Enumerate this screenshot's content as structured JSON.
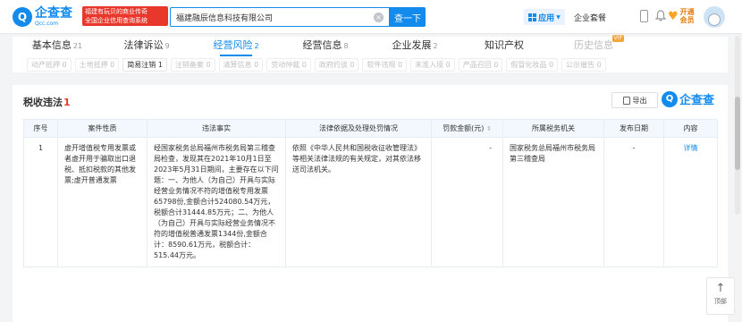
{
  "header": {
    "logo_mark": "Q",
    "logo_name": "企查查",
    "logo_domain": "Qcc.com",
    "promo_line1": "福建有玩贝的商业传奇",
    "promo_line2": "全国企业信用查询系统",
    "search_value": "福建融辰信息科技有限公司",
    "search_button": "查一下",
    "app_label": "应用",
    "package_label": "企业套餐",
    "vip_line1": "开通",
    "vip_line2": "会员"
  },
  "tabs": [
    {
      "label": "基本信息",
      "count": "21"
    },
    {
      "label": "法律诉讼",
      "count": "9"
    },
    {
      "label": "经营风险",
      "count": "2"
    },
    {
      "label": "经营信息",
      "count": "8"
    },
    {
      "label": "企业发展",
      "count": "2"
    },
    {
      "label": "知识产权",
      "count": ""
    },
    {
      "label": "历史信息",
      "count": "",
      "badge": "VIP"
    }
  ],
  "subtabs": [
    "动产抵押 0",
    "土地抵押 0",
    "简易注销 1",
    "注销备案 0",
    "清算信息 0",
    "劳动仲裁 0",
    "政府约谈 0",
    "软件违规 0",
    "未准入境 0",
    "产品召回 0",
    "假冒化妆品 0",
    "公示催告 0"
  ],
  "section": {
    "title": "税收违法",
    "count": "1",
    "export_label": "导出",
    "brand_mark": "Q",
    "brand_name": "企查查"
  },
  "table": {
    "headers": [
      "序号",
      "案件性质",
      "违法事实",
      "法律依据及处理处罚情况",
      "罚款金额(元)",
      "所属税务机关",
      "发布日期",
      "内容"
    ],
    "sort_icon": "⇕",
    "rows": [
      {
        "index": "1",
        "nature": "虚开增值税专用发票或者虚开用于骗取出口退税、抵扣税款的其他发票;虚开普通发票",
        "facts": "经国家税务总局福州市税务局第三稽查局检查，发现其在2021年10月1日至2023年5月31日期间，主要存在以下问题：一、为他人（为自己）开具与实际经营业务情况不符的增值税专用发票65798份,金额合计524080.54万元，税额合计31444.85万元；二、为他人（为自己）开具与实际经营业务情况不符的增值税普通发票1344份,金额合计：8590.61万元，税额合计：515.44万元。",
        "basis": "依照《中华人民共和国税收征收管理法》等相关法律法规的有关规定，对其依法移送司法机关。",
        "amount": "-",
        "authority": "国家税务总局福州市税务局第三稽查局",
        "date": "-",
        "detail": "详情"
      }
    ]
  },
  "to_top_label": "顶部",
  "to_top_arrow": "↑"
}
